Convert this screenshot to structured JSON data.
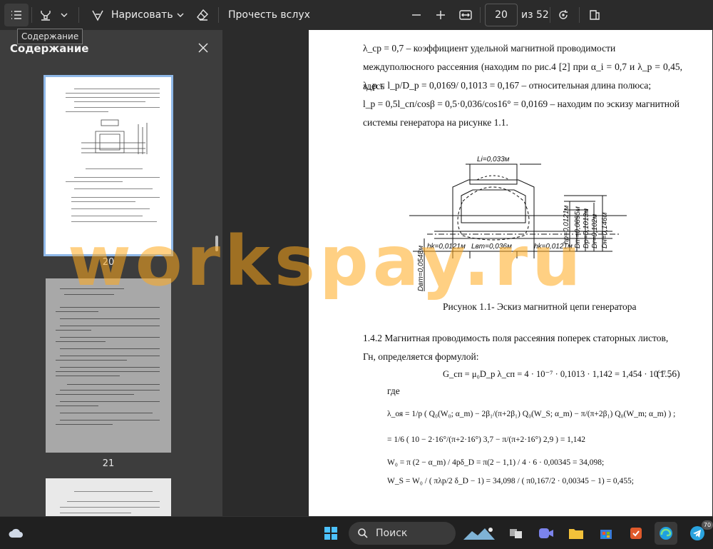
{
  "toolbar": {
    "toc_tooltip": "Содержание",
    "draw_label": "Нарисовать",
    "read_aloud_label": "Прочесть вслух",
    "page_current": "20",
    "page_total": "из 52"
  },
  "sidebar": {
    "title": "Содержание",
    "thumbnails": [
      {
        "page_number": "20",
        "selected": true
      },
      {
        "page_number": "21",
        "selected": false
      }
    ]
  },
  "document": {
    "line1": "λ_ср = 0,7   –   коэффициент   удельной   магнитной   проводимости",
    "line2": "междуполюсного рассеяния (находим по рис.4 [2] при  α_i = 0,7  и  λ_р = 0,45, здесь",
    "line3": "λ_р = l_р/D_р = 0,0169/ 0,1013 = 0,167  – относительная длина полюса;",
    "line4": "l_р = 0,5l_сп/cosβ = 0,5·0,036/cos16° = 0,0169   –  находим  по  эскизу  магнитной",
    "line5": "системы генератора на рисунке 1.1.",
    "figure_caption": "Рисунок 1.1- Эскиз магнитной цепи генератора",
    "section_line1": "1.4.2 Магнитная проводимость поля рассеяния поперек статорных листов,",
    "section_line2": "Гн, определяется формулой:",
    "formula_gcn": "G_сп = μ₀D_р λ_сп = 4 · 10⁻⁷ · 0,1013 · 1,142 = 1,454 · 10⁻⁷ ,",
    "formula_number": "(1.56)",
    "where_label": "где",
    "formula_lambda_a": "λ_оя = 1/p ( Q₀(W₀; α_m) − 2β₁/(π+2β₁) Q₀(W_S; α_m) − π/(π+2β₁) Q₀(W_m; α_m) ) ;",
    "formula_lambda_b": "= 1/6 ( 10 − 2·16°/(π+2·16°) 3,7 − π/(π+2·16°) 2,9 ) = 1,142",
    "formula_w0": "W₀ = π (2 − α_m) / 4pδ_D = π(2 − 1,1) / 4 · 6 · 0,00345 = 34,098;",
    "formula_ws": "W_S = W₀ / ( πλp/2 δ_D − 1) = 34,098 / ( π0,167/2 · 0,00345 − 1) = 0,455;"
  },
  "figure": {
    "label_li": "Li=0,033м",
    "label_hk_left": "hk=0,0121м",
    "label_lbm": "Lвm=0,036м",
    "label_hk_right": "hk=0,0121м",
    "label_hp": "hp=0,0121м",
    "label_dm": "Dm=0,0895м",
    "label_dp": "Dp=0,1013м",
    "label_dr": "Dr=0,102м",
    "label_dh": "Dн=0,146м",
    "label_dbm": "Dвm=0,0548м"
  },
  "watermark": "workspay.ru",
  "taskbar": {
    "search_label": "Поиск",
    "telegram_badge": "70"
  },
  "colors": {
    "toolbar_bg": "#2b2b2b",
    "sidebar_bg": "#3d3d3d",
    "selection_outline": "#8fb8e8",
    "watermark": "#ffaa1e",
    "taskbar_bg": "#202020"
  }
}
